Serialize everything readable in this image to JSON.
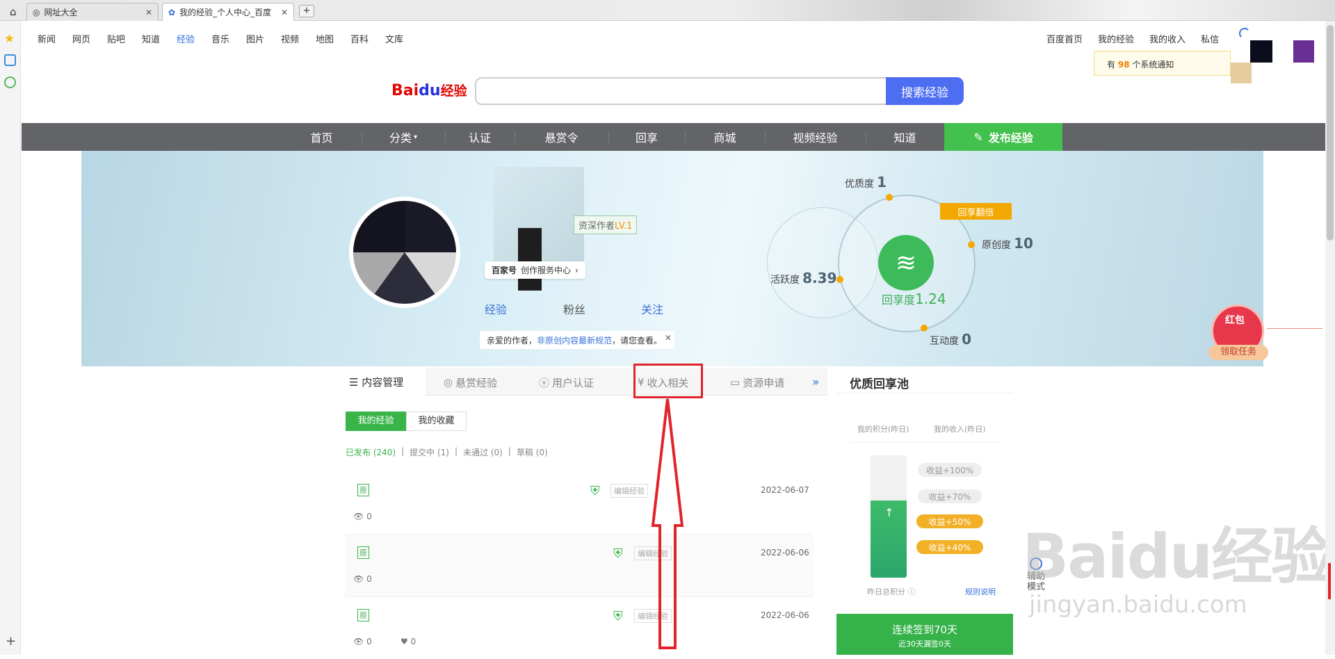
{
  "browser": {
    "tabs": [
      {
        "label": "网址大全"
      },
      {
        "label": "我的经验_个人中心_百度"
      }
    ],
    "new_tab": "+"
  },
  "topnav": {
    "left": [
      "新闻",
      "网页",
      "贴吧",
      "知道",
      "经验",
      "音乐",
      "图片",
      "视频",
      "地图",
      "百科",
      "文库"
    ],
    "right": [
      "百度首页",
      "我的经验",
      "我的收入",
      "私信"
    ],
    "notice_prefix": "有",
    "notice_count": "98",
    "notice_suffix": "个系统通知"
  },
  "search": {
    "logo": "Baidu经验",
    "button": "搜索经验",
    "placeholder": ""
  },
  "mainnav": {
    "items": [
      "首页",
      "分类",
      "认证",
      "悬赏令",
      "回享",
      "商城",
      "视频经验",
      "知道"
    ],
    "publish": "发布经验"
  },
  "profile": {
    "badge_prefix": "资深作者",
    "badge_level": "LV.1",
    "baijiahao": "百家号",
    "creator_center": "创作服务中心",
    "links": [
      "经验",
      "粉丝",
      "关注"
    ],
    "tip_prefix": "亲爱的作者，",
    "tip_link": "非原创内容最新规范",
    "tip_suffix": "，请您查看。"
  },
  "stats": {
    "quality_label": "优质度",
    "quality": "1",
    "originality_label": "原创度",
    "originality": "10",
    "activity_label": "活跃度",
    "activity": "8.39",
    "interaction_label": "互动度",
    "interaction": "0",
    "share_label": "回享度",
    "share": "1.24",
    "double_badge": "回享翻倍"
  },
  "redpacket": {
    "title": "红包",
    "task": "领取任务"
  },
  "panel": {
    "tabs": [
      "内容管理",
      "悬赏经验",
      "用户认证",
      "收入相关",
      "资源申请"
    ],
    "more": "»",
    "subtabs": [
      "我的经验",
      "我的收藏"
    ],
    "filters": [
      "已发布 (240)",
      "提交中 (1)",
      "未通过 (0)",
      "草稿 (0)"
    ],
    "rows": [
      {
        "date": "2022-06-07",
        "views": "0",
        "edit": "编辑经验"
      },
      {
        "date": "2022-06-06",
        "views": "0",
        "edit": "编辑经验"
      },
      {
        "date": "2022-06-06",
        "views": "0",
        "likes": "0",
        "edit": "编辑经验"
      }
    ]
  },
  "right": {
    "title": "优质回享池",
    "col1": "我的积分(昨日)",
    "col2": "我的收入(昨日)",
    "pills": [
      "收益+100%",
      "收益+70%",
      "收益+50%",
      "收益+40%"
    ],
    "yesterday": "昨日总积分",
    "rules": "规则说明",
    "signin_title": "连续签到70天",
    "signin_sub": "近30天漏签0天"
  },
  "assist": "辅助模式",
  "watermark": "Baidu经验",
  "watermark2": "jingyan.baidu.com"
}
